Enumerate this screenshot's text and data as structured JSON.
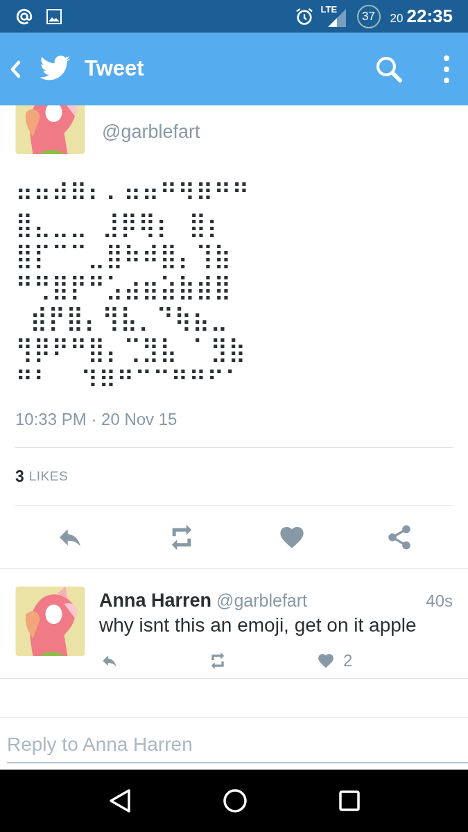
{
  "status_bar": {
    "network": "LTE",
    "battery": "37",
    "date": "20",
    "time": "22:35"
  },
  "app_bar": {
    "title": "Tweet"
  },
  "tweet": {
    "handle": "@garblefart",
    "text": "⠶⠶⠾⠿⠆⠄⠶⠶⠛⠻⠿⠛⠛\n⣿⣄⣀⣀ ⣸⡿⢿⡆ ⣿⡆\n⣿⡏⠉⠉⣀⣿⠷⠾⣿⡄⢹⣷\n⠛⢛⣿⡟⠛⣡⣴⣶⣵⣷⣾⣿\n ⣾⡟⣿⡄⢻⣧⡀⠙⢷⣦⣀\n⢻⡿⠟⠛⣿⡄⢉⣻⣧ ⠁⣻⣷\n⠛⠃  ⠹⠿⠛⠉⠉⠛⠛⠋⠁",
    "timestamp": "10:33 PM · 20 Nov 15",
    "likes_count": "3",
    "likes_label": "LIKES"
  },
  "replies": [
    {
      "name": "Anna Harren",
      "handle": "@garblefart",
      "time": "40s",
      "text": "why isnt this an emoji, get on it apple",
      "likes": "2"
    }
  ],
  "reply_field": {
    "placeholder": "Reply to Anna Harren"
  }
}
